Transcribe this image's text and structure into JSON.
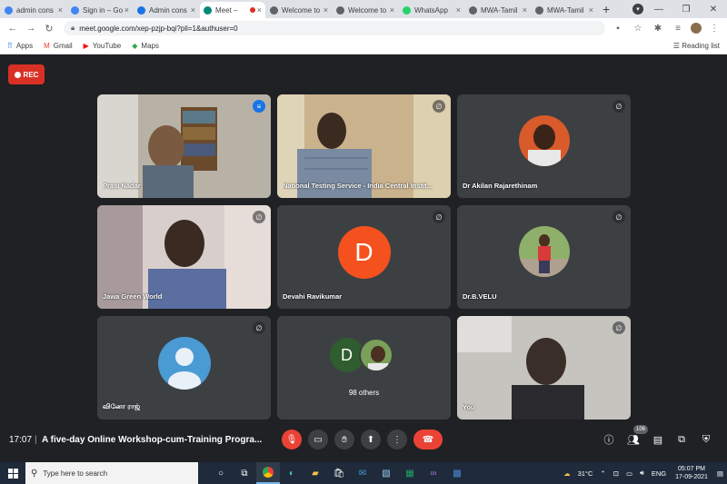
{
  "browser": {
    "tabs": [
      {
        "title": "admin cons",
        "favicon": "google-icon",
        "color": "#4285f4",
        "active": false
      },
      {
        "title": "Sign in – Go",
        "favicon": "google-icon",
        "color": "#4285f4",
        "active": false
      },
      {
        "title": "Admin cons",
        "favicon": "admin-console-icon",
        "color": "#1a73e8",
        "active": false
      },
      {
        "title": "Meet –",
        "favicon": "meet-icon",
        "color": "#00897b",
        "active": true,
        "recording": true
      },
      {
        "title": "Welcome to",
        "favicon": "globe-icon",
        "color": "#5f6368",
        "active": false
      },
      {
        "title": "Welcome to",
        "favicon": "globe-icon",
        "color": "#5f6368",
        "active": false
      },
      {
        "title": "WhatsApp",
        "favicon": "whatsapp-icon",
        "color": "#25d366",
        "active": false
      },
      {
        "title": "MWA-Tamil",
        "favicon": "globe-icon",
        "color": "#5f6368",
        "active": false
      },
      {
        "title": "MWA-Tamil",
        "favicon": "globe-icon",
        "color": "#5f6368",
        "active": false
      }
    ],
    "url": "meet.google.com/xep-pzjp-bqi?pli=1&authuser=0",
    "bookmarks": [
      {
        "label": "Apps",
        "icon": "apps-grid-icon"
      },
      {
        "label": "Gmail",
        "icon": "gmail-icon"
      },
      {
        "label": "YouTube",
        "icon": "youtube-icon"
      },
      {
        "label": "Maps",
        "icon": "maps-icon"
      }
    ],
    "reading_list": "Reading list"
  },
  "meet": {
    "rec_label": "REC",
    "participants": [
      {
        "name": "Prasi Nadar",
        "kind": "video",
        "speaking": true
      },
      {
        "name": "National Testing Service - India Central Instit...",
        "kind": "video",
        "speaking": false
      },
      {
        "name": "Dr Akilan Rajarethinam",
        "kind": "photo",
        "speaking": false
      },
      {
        "name": "Jawa Green World",
        "kind": "video",
        "speaking": false
      },
      {
        "name": "Devahi Ravikumar",
        "kind": "letter",
        "letter": "D",
        "color": "#f4511e",
        "speaking": false
      },
      {
        "name": "Dr.B.VELU",
        "kind": "photo",
        "speaking": false
      },
      {
        "name": "வினோ ராஜ்",
        "kind": "default-avatar",
        "speaking": false
      },
      {
        "name": "98 others",
        "kind": "others",
        "letter": "D",
        "speaking": false
      },
      {
        "name": "You",
        "kind": "video",
        "speaking": false
      }
    ],
    "time": "17:07",
    "separator": "|",
    "meeting_title": "A five-day Online Workshop-cum-Training Progra...",
    "people_count": "106"
  },
  "taskbar": {
    "search_placeholder": "Type here to search",
    "weather": "31°C",
    "language": "ENG",
    "clock_time": "05:07 PM",
    "clock_date": "17-09-2021"
  }
}
